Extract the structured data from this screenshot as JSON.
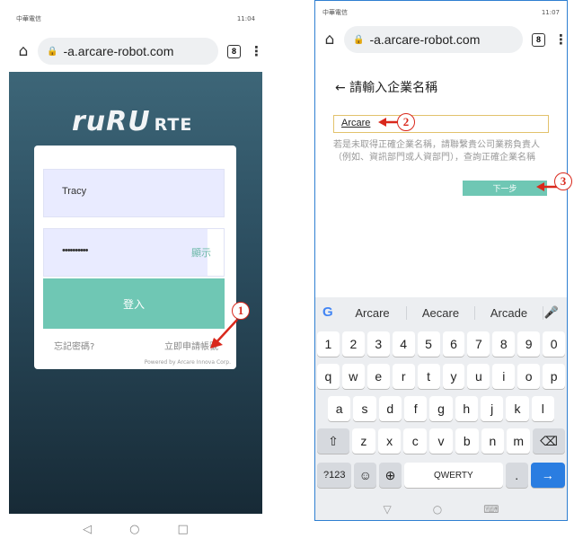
{
  "phone1": {
    "status": {
      "carrier": "中華電信",
      "time": "11:04"
    },
    "url": "-a.arcare-robot.com",
    "tab_count": "8",
    "logo": {
      "main": "ruRU",
      "suffix": "RTE"
    },
    "username": "Tracy",
    "password": "••••••••••",
    "show_label": "顯示",
    "login_label": "登入",
    "forgot_label": "忘記密碼?",
    "apply_label": "立即申請帳號",
    "powered": "Powered by Arcare Innova Corp.",
    "nav": {
      "back": "◁",
      "home": "○",
      "recent": "□"
    }
  },
  "phone2": {
    "status": {
      "carrier": "中華電信",
      "time": "11:07"
    },
    "url": "-a.arcare-robot.com",
    "tab_count": "8",
    "title": "← 請輸入企業名稱",
    "input_value": "Arcare",
    "hint": "若是未取得正確企業名稱，請聯繫貴公司業務負責人（例如、資訊部門或人資部門），查詢正確企業名稱",
    "next_label": "下一步",
    "suggestions": [
      "Arcare",
      "Aecare",
      "Arcade"
    ],
    "rows": [
      [
        "1",
        "2",
        "3",
        "4",
        "5",
        "6",
        "7",
        "8",
        "9",
        "0"
      ],
      [
        "q",
        "w",
        "e",
        "r",
        "t",
        "y",
        "u",
        "i",
        "o",
        "p"
      ],
      [
        "a",
        "s",
        "d",
        "f",
        "g",
        "h",
        "j",
        "k",
        "l"
      ],
      [
        "⇧",
        "z",
        "x",
        "c",
        "v",
        "b",
        "n",
        "m",
        "⌫"
      ],
      [
        "?123",
        "☺",
        "⊕",
        "QWERTY",
        ".",
        "→"
      ]
    ],
    "nav": {
      "back": "▽",
      "home": "○",
      "recent": "⌨"
    }
  },
  "markers": [
    "1",
    "2",
    "3"
  ],
  "accent": "#6fc7b4",
  "marker_color": "#d9281c"
}
